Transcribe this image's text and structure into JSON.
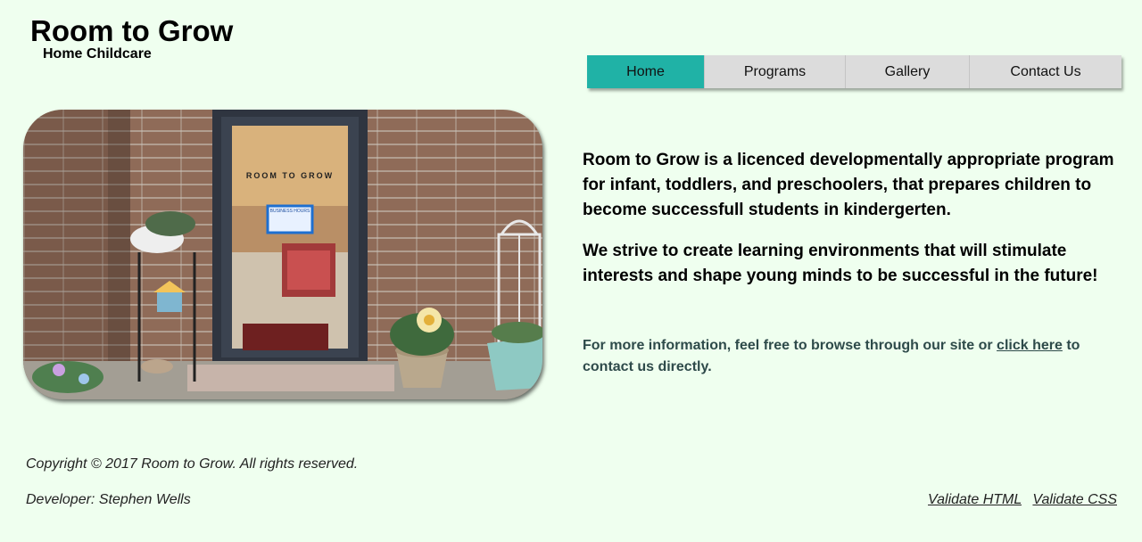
{
  "header": {
    "title": "Room to Grow",
    "subtitle": "Home Childcare"
  },
  "nav": {
    "items": [
      {
        "label": "Home",
        "active": true
      },
      {
        "label": "Programs",
        "active": false
      },
      {
        "label": "Gallery",
        "active": false
      },
      {
        "label": "Contact Us",
        "active": false
      }
    ]
  },
  "photo": {
    "door_lettering": "ROOM TO GROW",
    "sign_text": "BUSINESS HOURS"
  },
  "main": {
    "paragraph1": "Room to Grow is a licenced developmentally appropriate program for infant, toddlers, and preschoolers, that prepares children to become successfull students in kindergerten.",
    "paragraph2": "We strive to create learning environments that will stimulate interests and shape young minds to be successful in the future!",
    "info_before": "For more information, feel free to browse through our site or ",
    "info_link": "click here",
    "info_after": " to contact us directly."
  },
  "footer": {
    "copyright": "Copyright © 2017 Room to Grow. All rights reserved.",
    "developer": "Developer: Stephen Wells",
    "validate_html": "Validate HTML",
    "validate_css": "Validate CSS"
  },
  "colors": {
    "page_background": "#efffef",
    "nav_active": "#20b2a6",
    "nav_inactive": "#dcdcdc"
  }
}
